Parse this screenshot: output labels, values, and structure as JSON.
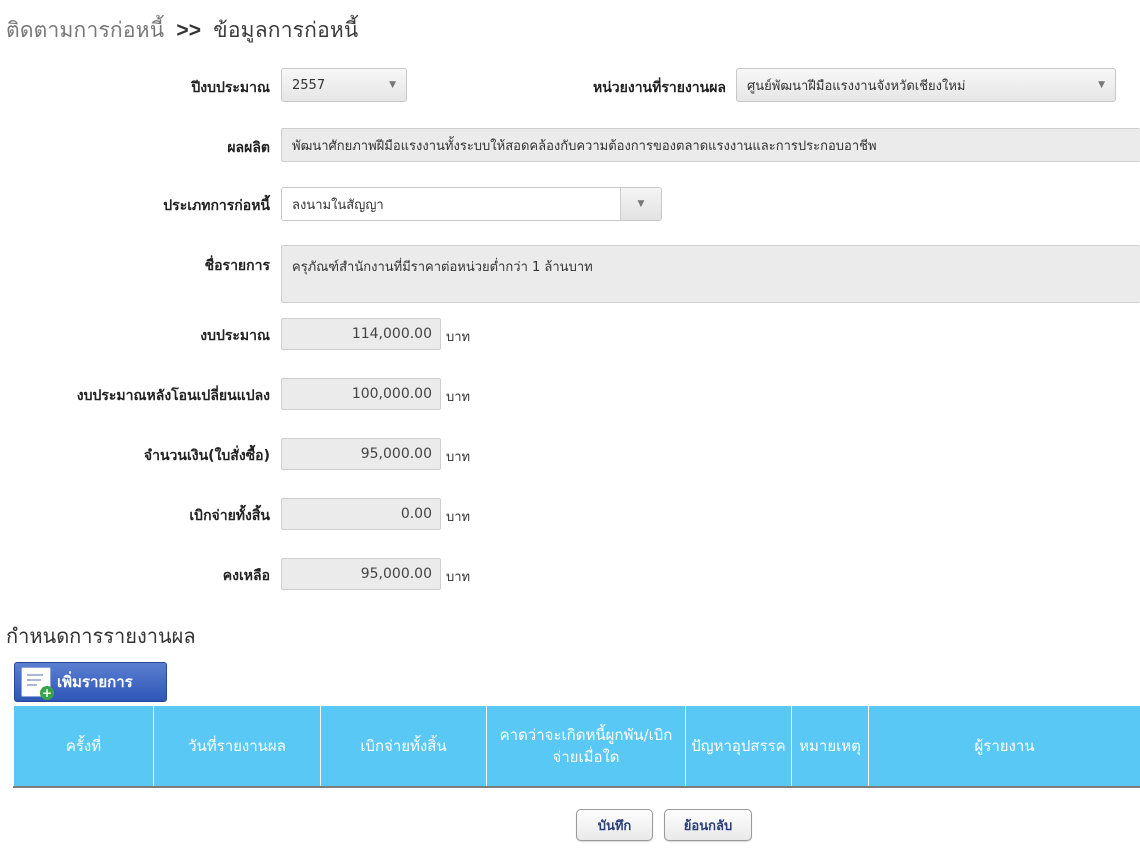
{
  "header": {
    "breadcrumb": "ติดตามการก่อหนี้",
    "separator": ">>",
    "title": "ข้อมูลการก่อหนี้"
  },
  "form": {
    "fiscal_year": {
      "label": "ปีงบประมาณ",
      "value": "2557"
    },
    "unit": {
      "label": "หน่วยงานที่รายงานผล",
      "value": "ศูนย์พัฒนาฝีมือแรงงานจังหวัดเชียงใหม่"
    },
    "output": {
      "label": "ผลผลิต",
      "value": "พัฒนาศักยภาพฝีมือแรงงานทั้งระบบให้สอดคล้องกับความต้องการของตลาดแรงงานและการประกอบอาชีพ"
    },
    "obligation_type": {
      "label": "ประเภทการก่อหนี้",
      "value": "ลงนามในสัญญา"
    },
    "item_name": {
      "label": "ชื่อรายการ",
      "value": "ครุภัณฑ์สำนักงานที่มีราคาต่อหน่วยต่ำกว่า 1 ล้านบาท"
    },
    "budget": {
      "label": "งบประมาณ",
      "value": "114,000.00",
      "unit": "บาท"
    },
    "budget_after_transfer": {
      "label": "งบประมาณหลังโอนเปลี่ยนแปลง",
      "value": "100,000.00",
      "unit": "บาท"
    },
    "po_amount": {
      "label": "จำนวนเงิน(ใบสั่งซื้อ)",
      "value": "95,000.00",
      "unit": "บาท"
    },
    "total_disbursed": {
      "label": "เบิกจ่ายทั้งสิ้น",
      "value": "0.00",
      "unit": "บาท"
    },
    "remaining": {
      "label": "คงเหลือ",
      "value": "95,000.00",
      "unit": "บาท"
    }
  },
  "report_section": {
    "title": "กำหนดการรายงานผล",
    "add_button": "เพิ่มรายการ",
    "columns": [
      "ครั้งที่",
      "วันที่รายงานผล",
      "เบิกจ่ายทั้งสิ้น",
      "คาดว่าจะเกิดหนี้ผูกพัน/เบิกจ่ายเมื่อใด",
      "ปัญหาอุปสรรค",
      "หมายเหตุ",
      "ผู้รายงาน"
    ]
  },
  "actions": {
    "save": "บันทึก",
    "back": "ย้อนกลับ"
  },
  "icons": {
    "dropdown": "chevron-down-icon",
    "add": "document-add-icon"
  },
  "colors": {
    "table_header": "#5ac8f5",
    "add_button": "#2e56b7"
  }
}
